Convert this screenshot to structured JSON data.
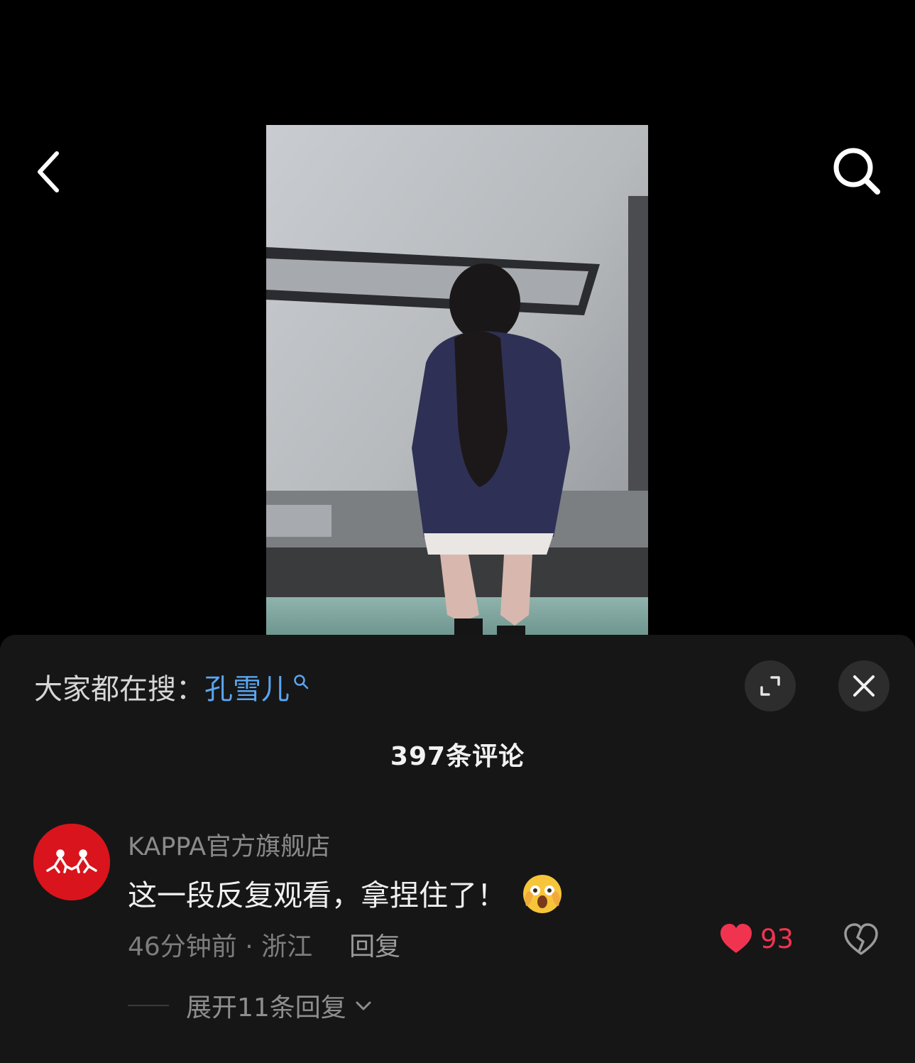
{
  "hot_search": {
    "prefix": "大家都在搜：",
    "keyword": "孔雪儿"
  },
  "comments_header": {
    "count_label": "397条评论"
  },
  "comment": {
    "author": "KAPPA官方旗舰店",
    "text": "这一段反复观看，拿捏住了！",
    "emoji": "😫",
    "time": "46分钟前 · 浙江",
    "reply_label": "回复",
    "like_count": "93",
    "expand_label": "展开11条回复"
  },
  "icons": {
    "back": "chevron-left-icon",
    "search": "search-icon",
    "expand": "expand-icon",
    "close": "close-icon",
    "like": "heart-icon",
    "dislike": "broken-heart-icon"
  },
  "colors": {
    "background": "#000000",
    "sheet": "#161616",
    "keyword": "#5aa6f0",
    "like": "#f0344f",
    "avatar": "#d9141c"
  }
}
